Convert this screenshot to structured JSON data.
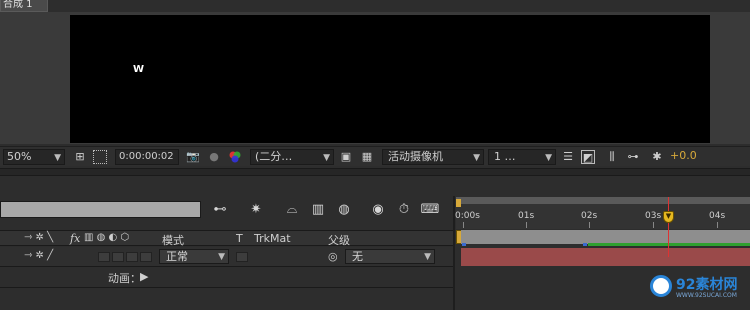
{
  "window": {
    "tab_title": "合成 1"
  },
  "viewer": {
    "canvas_text": "W",
    "zoom": "50%",
    "timecode": "0:00:00:02",
    "resolution": "(二分…",
    "camera": "活动摄像机",
    "views": "1 …",
    "exposure": "+0.0"
  },
  "timeline": {
    "ruler_labels": [
      "0:00s",
      "01s",
      "02s",
      "03s",
      "04s"
    ],
    "columns": {
      "fx": "fx",
      "mode": "模式",
      "t": "T",
      "trkmat": "TrkMat",
      "parent": "父级"
    },
    "layer": {
      "mode": "正常",
      "parent": "无",
      "anim_label": "动画："
    }
  },
  "watermark": {
    "name": "92素材网",
    "url": "WWW.92SUCAI.COM"
  },
  "colors": {
    "layer_bar": "#9a4a4a",
    "cti": "#e6b820",
    "work_area": "#d7a93a"
  }
}
